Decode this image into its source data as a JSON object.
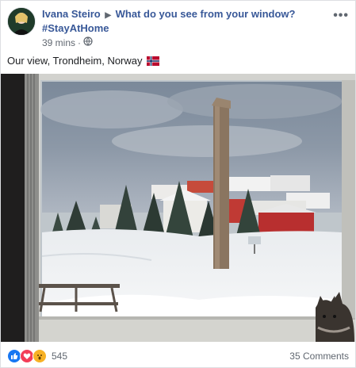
{
  "post": {
    "author": "Ivana Steiro",
    "group": "What do you see from your window?",
    "hashtag": "#StayAtHome",
    "time": "39 mins",
    "text": "Our view, Trondheim, Norway",
    "menu": "•••"
  },
  "photo_icons": {
    "globe": "globe-icon",
    "flag": "norway-flag-icon",
    "cat": "cat-icon"
  },
  "footer": {
    "reaction_count": "545",
    "comments": "35 Comments"
  },
  "colors": {
    "link": "#385898",
    "meta": "#606770",
    "like": "#1877f2",
    "love": "#f33e58",
    "wow": "#f7b125"
  }
}
